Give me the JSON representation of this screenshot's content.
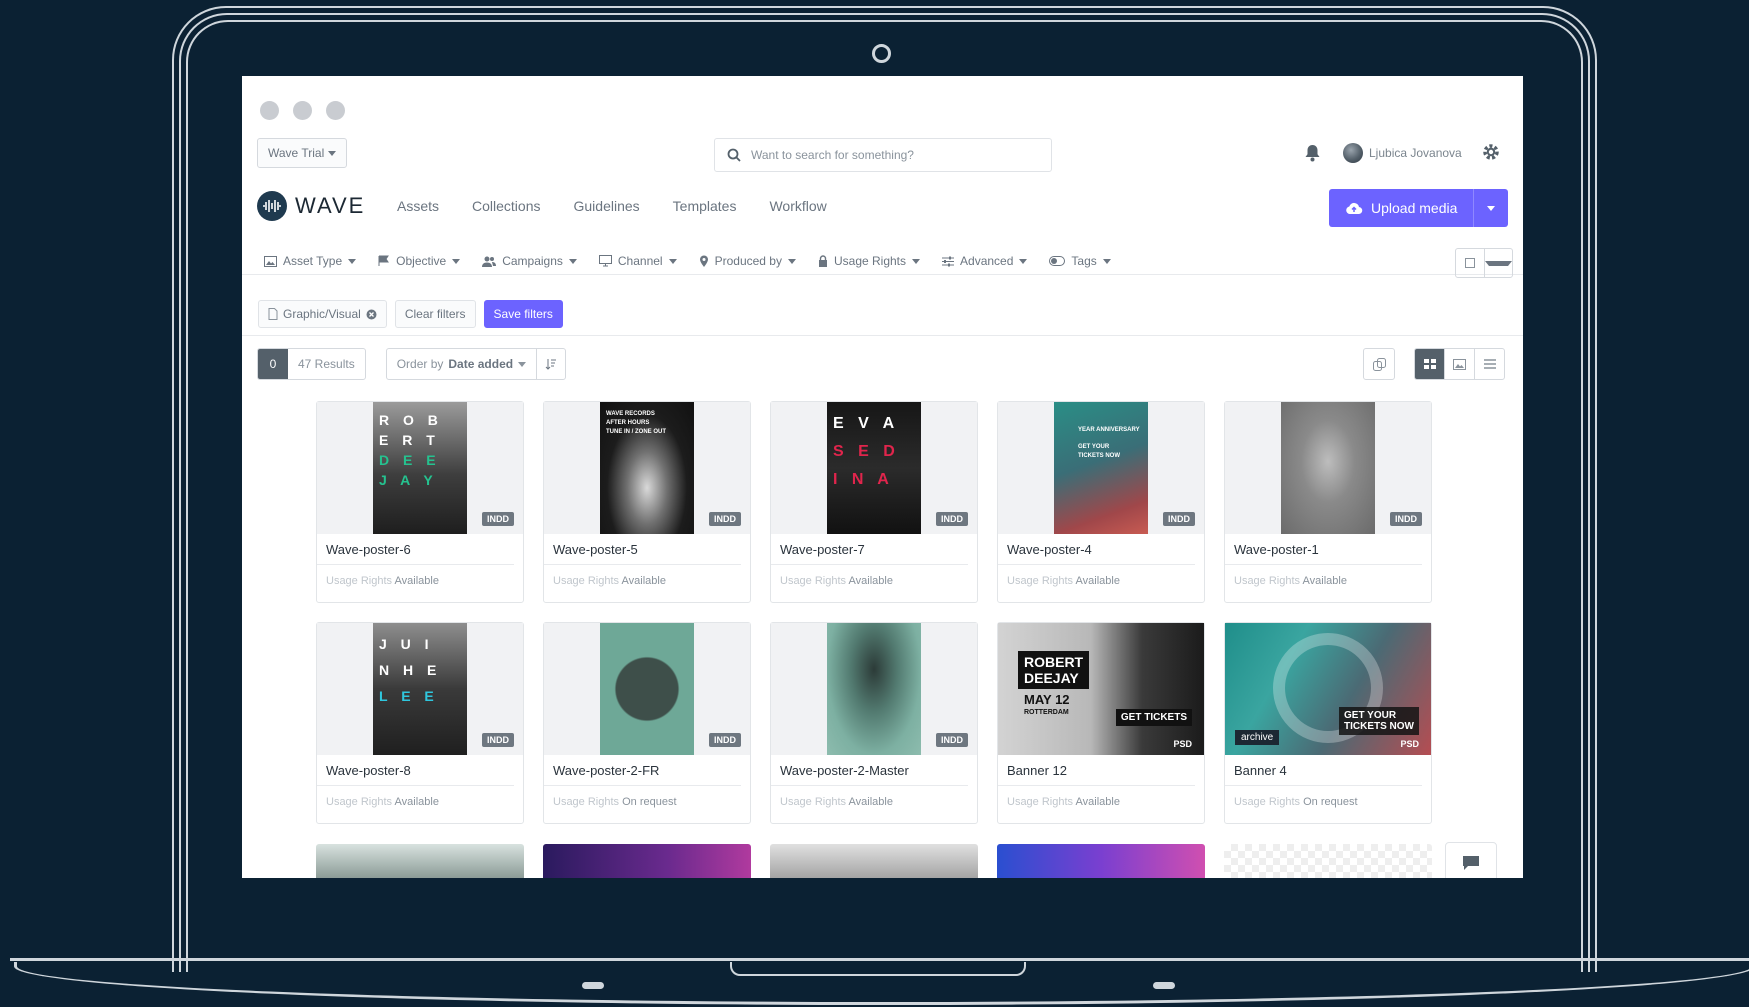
{
  "window": {
    "workspace": "Wave Trial"
  },
  "search": {
    "placeholder": "Want to search for something?"
  },
  "user": {
    "name": "Ljubica Jovanova"
  },
  "brand": {
    "name": "WAVE",
    "accent": "#6c63ff"
  },
  "nav": [
    "Assets",
    "Collections",
    "Guidelines",
    "Templates",
    "Workflow"
  ],
  "upload": {
    "label": "Upload media"
  },
  "filters": [
    {
      "label": "Asset Type",
      "icon": "image-icon"
    },
    {
      "label": "Objective",
      "icon": "flag-icon"
    },
    {
      "label": "Campaigns",
      "icon": "users-icon"
    },
    {
      "label": "Channel",
      "icon": "monitor-icon"
    },
    {
      "label": "Produced by",
      "icon": "map-pin-icon"
    },
    {
      "label": "Usage Rights",
      "icon": "lock-icon"
    },
    {
      "label": "Advanced",
      "icon": "sliders-icon"
    },
    {
      "label": "Tags",
      "icon": "toggle-icon"
    }
  ],
  "active_filter": {
    "label": "Graphic/Visual"
  },
  "filter_actions": {
    "clear": "Clear filters",
    "save": "Save filters"
  },
  "results": {
    "selected": "0",
    "count": "47 Results",
    "order_prefix": "Order by",
    "order_value": "Date added"
  },
  "usage_label": "Usage Rights",
  "assets": [
    {
      "title": "Wave-poster-6",
      "type": "INDD",
      "rights": "Available",
      "art": "ROBERT DEEJAY"
    },
    {
      "title": "Wave-poster-5",
      "type": "INDD",
      "rights": "Available",
      "art": "WAVE RECORDS AFTER HOURS"
    },
    {
      "title": "Wave-poster-7",
      "type": "INDD",
      "rights": "Available",
      "art": "EVA SEDINA"
    },
    {
      "title": "Wave-poster-4",
      "type": "INDD",
      "rights": "Available",
      "art": "GET YOUR TICKETS NOW"
    },
    {
      "title": "Wave-poster-1",
      "type": "INDD",
      "rights": "Available",
      "art": ""
    },
    {
      "title": "Wave-poster-8",
      "type": "INDD",
      "rights": "Available",
      "art": "JUNIHLEE"
    },
    {
      "title": "Wave-poster-2-FR",
      "type": "INDD",
      "rights": "On request",
      "art": ""
    },
    {
      "title": "Wave-poster-2-Master",
      "type": "INDD",
      "rights": "Available",
      "art": ""
    },
    {
      "title": "Banner 12",
      "type": "PSD",
      "rights": "Available",
      "art": "ROBERT DEEJAY MAY 12 ROTTERDAM GET TICKETS"
    },
    {
      "title": "Banner 4",
      "type": "PSD",
      "rights": "On request",
      "art": "archive GET YOUR TICKETS NOW"
    }
  ],
  "thumb_art": {
    "p6": {
      "line1": "R O B",
      "line2": "E R T",
      "line3": "D E E",
      "line4": "J A Y"
    },
    "p5": {
      "line1": "WAVE RECORDS",
      "line2": "AFTER HOURS",
      "line3": "TUNE IN / ZONE OUT"
    },
    "p7": {
      "line1": "E V A",
      "line2": "S E D",
      "line3": "I N A"
    },
    "p4": {
      "line1": "YEAR ANNIVERSARY",
      "line2": "GET YOUR",
      "line3": "TICKETS NOW"
    },
    "p8": {
      "line1": "J U I",
      "line2": "N H E",
      "line3": "L E E"
    },
    "b12": {
      "line1": "ROBERT",
      "line2": "DEEJAY",
      "line3": "MAY 12",
      "line4": "ROTTERDAM",
      "line5": "GET TICKETS"
    },
    "b4": {
      "line1": "archive",
      "line2": "GET YOUR",
      "line3": "TICKETS NOW"
    }
  }
}
